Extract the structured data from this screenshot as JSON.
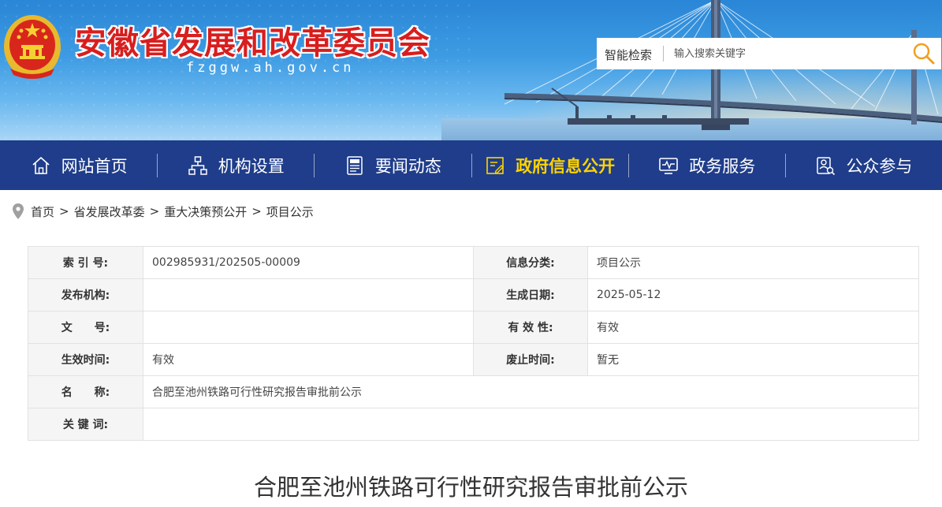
{
  "header": {
    "site_title": "安徽省发展和改革委员会",
    "domain": "fzggw.ah.gov.cn",
    "search": {
      "label": "智能检索",
      "placeholder": "输入搜索关键字"
    }
  },
  "nav": {
    "items": [
      {
        "label": "网站首页",
        "icon": "home-icon"
      },
      {
        "label": "机构设置",
        "icon": "org-chart-icon"
      },
      {
        "label": "要闻动态",
        "icon": "news-icon"
      },
      {
        "label": "政府信息公开",
        "icon": "document-icon",
        "active": true
      },
      {
        "label": "政务服务",
        "icon": "monitor-icon"
      },
      {
        "label": "公众参与",
        "icon": "person-search-icon"
      }
    ]
  },
  "breadcrumb": {
    "items": [
      "首页",
      "省发展改革委",
      "重大决策预公开",
      "项目公示"
    ],
    "separator": ">"
  },
  "info": {
    "index_label": "索 引 号:",
    "index_value": "002985931/202505-00009",
    "category_label": "信息分类:",
    "category_value": "项目公示",
    "publisher_label": "发布机构:",
    "publisher_value": "",
    "date_label": "生成日期:",
    "date_value": "2025-05-12",
    "docno_label": "文　　号:",
    "docno_value": "",
    "validity_label": "有 效 性:",
    "validity_value": "有效",
    "effective_label": "生效时间:",
    "effective_value": "有效",
    "expiry_label": "废止时间:",
    "expiry_value": "暂无",
    "name_label": "名　　称:",
    "name_value": "合肥至池州铁路可行性研究报告审批前公示",
    "keywords_label": "关 键 词:",
    "keywords_value": ""
  },
  "article": {
    "title": "合肥至池州铁路可行性研究报告审批前公示"
  },
  "colors": {
    "nav_bg": "#1f3d8a",
    "nav_active": "#ffd400",
    "title_red": "#d81e1e",
    "search_icon": "#f0a020"
  }
}
